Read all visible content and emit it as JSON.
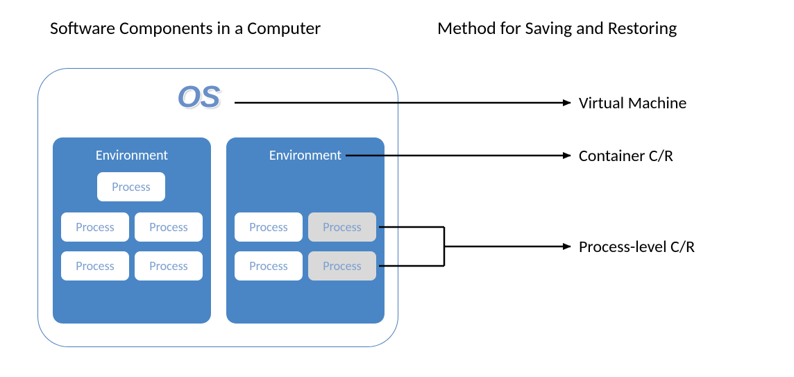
{
  "headings": {
    "left": "Software Components in a Computer",
    "right": "Method for Saving and Restoring"
  },
  "os_label": "OS",
  "environments": {
    "env1": {
      "label": "Environment",
      "processes": [
        "Process",
        "Process",
        "Process",
        "Process",
        "Process"
      ]
    },
    "env2": {
      "label": "Environment",
      "processes": [
        "Process",
        "Process",
        "Process",
        "Process"
      ]
    }
  },
  "methods": {
    "vm": "Virtual Machine",
    "container": "Container C/R",
    "process": "Process-level C/R"
  },
  "colors": {
    "env_bg": "#4a86c5",
    "os_border": "#4a7ebb",
    "proc_text": "#7c9fcf",
    "proc_gray": "#d9d9d9"
  }
}
